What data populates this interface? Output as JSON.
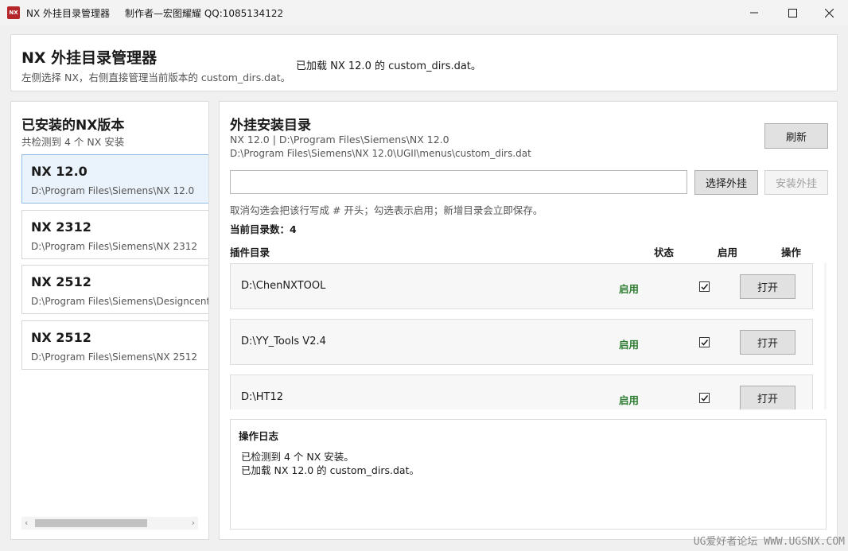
{
  "window": {
    "icon_text": "NX",
    "title": "NX 外挂目录管理器",
    "author": "制作者—宏图耀耀 QQ:1085134122"
  },
  "header": {
    "title": "NX 外挂目录管理器",
    "subtitle": "左侧选择 NX，右侧直接管理当前版本的 custom_dirs.dat。",
    "status": "已加载 NX 12.0 的 custom_dirs.dat。"
  },
  "left_panel": {
    "title": "已安装的NX版本",
    "subtitle": "共检测到 4 个 NX 安装",
    "versions": [
      {
        "name": "NX 12.0",
        "path": "D:\\Program Files\\Siemens\\NX 12.0",
        "selected": true
      },
      {
        "name": "NX 2312",
        "path": "D:\\Program Files\\Siemens\\NX 2312",
        "selected": false
      },
      {
        "name": "NX 2512",
        "path": "D:\\Program Files\\Siemens\\Designcenter",
        "selected": false
      },
      {
        "name": "NX 2512",
        "path": "D:\\Program Files\\Siemens\\NX 2512",
        "selected": false
      }
    ],
    "scroll_left_icon": "chevron-left-icon",
    "scroll_right_icon": "chevron-right-icon"
  },
  "right_panel": {
    "title": "外挂安装目录",
    "path_line1": "NX 12.0  |  D:\\Program Files\\Siemens\\NX 12.0",
    "path_line2": "D:\\Program Files\\Siemens\\NX 12.0\\UGII\\menus\\custom_dirs.dat",
    "refresh_label": "刷新",
    "input_value": "",
    "choose_label": "选择外挂",
    "install_label": "安装外挂",
    "hint": "取消勾选会把该行写成 # 开头；勾选表示启用；新增目录会立即保存。",
    "count": "当前目录数：4",
    "columns": {
      "dir": "插件目录",
      "status": "状态",
      "enable": "启用",
      "action": "操作"
    },
    "rows": [
      {
        "path": "D:\\ChenNXTOOL",
        "status": "启用",
        "enabled": true,
        "action": "打开"
      },
      {
        "path": "D:\\YY_Tools V2.4",
        "status": "启用",
        "enabled": true,
        "action": "打开"
      },
      {
        "path": "D:\\HT12",
        "status": "启用",
        "enabled": true,
        "action": "打开"
      }
    ],
    "status_color": "#2e7d32"
  },
  "log": {
    "title": "操作日志",
    "lines": [
      "已检测到 4 个 NX 安装。",
      "已加载 NX 12.0 的 custom_dirs.dat。"
    ]
  },
  "watermark": "UG爱好者论坛 WWW.UGSNX.COM"
}
